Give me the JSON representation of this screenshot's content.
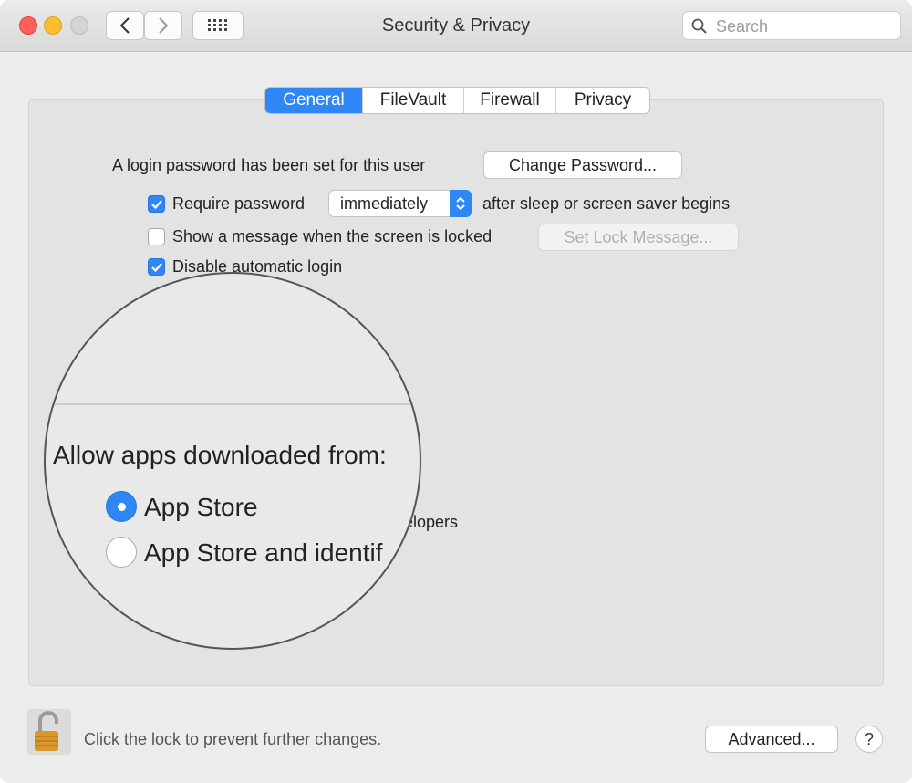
{
  "window": {
    "title": "Security & Privacy",
    "search_placeholder": "Search"
  },
  "tabs": [
    {
      "label": "General",
      "active": true
    },
    {
      "label": "FileVault",
      "active": false
    },
    {
      "label": "Firewall",
      "active": false
    },
    {
      "label": "Privacy",
      "active": false
    }
  ],
  "general": {
    "login_password_text": "A login password has been set for this user",
    "change_password_button": "Change Password...",
    "require_password": {
      "label": "Require password",
      "checked": true
    },
    "require_password_select": "immediately",
    "require_password_suffix": "after sleep or screen saver begins",
    "show_message": {
      "label": "Show a message when the screen is locked",
      "checked": false
    },
    "set_lock_message_button": "Set Lock Message...",
    "disable_auto_login": {
      "label": "Disable automatic login",
      "checked": true
    }
  },
  "allow_apps": {
    "heading": "Allow apps downloaded from:",
    "options": [
      {
        "label": "App Store",
        "selected": true
      },
      {
        "label": "App Store and identif",
        "selected": false
      }
    ],
    "hidden_option_tail": "elopers"
  },
  "footer": {
    "lock_text": "Click the lock to prevent further changes.",
    "advanced_button": "Advanced...",
    "help_button": "?"
  },
  "colors": {
    "accent": "#2f86f5",
    "close": "#fe5f57",
    "minimize": "#febc2e",
    "lock": "#d9962b"
  }
}
